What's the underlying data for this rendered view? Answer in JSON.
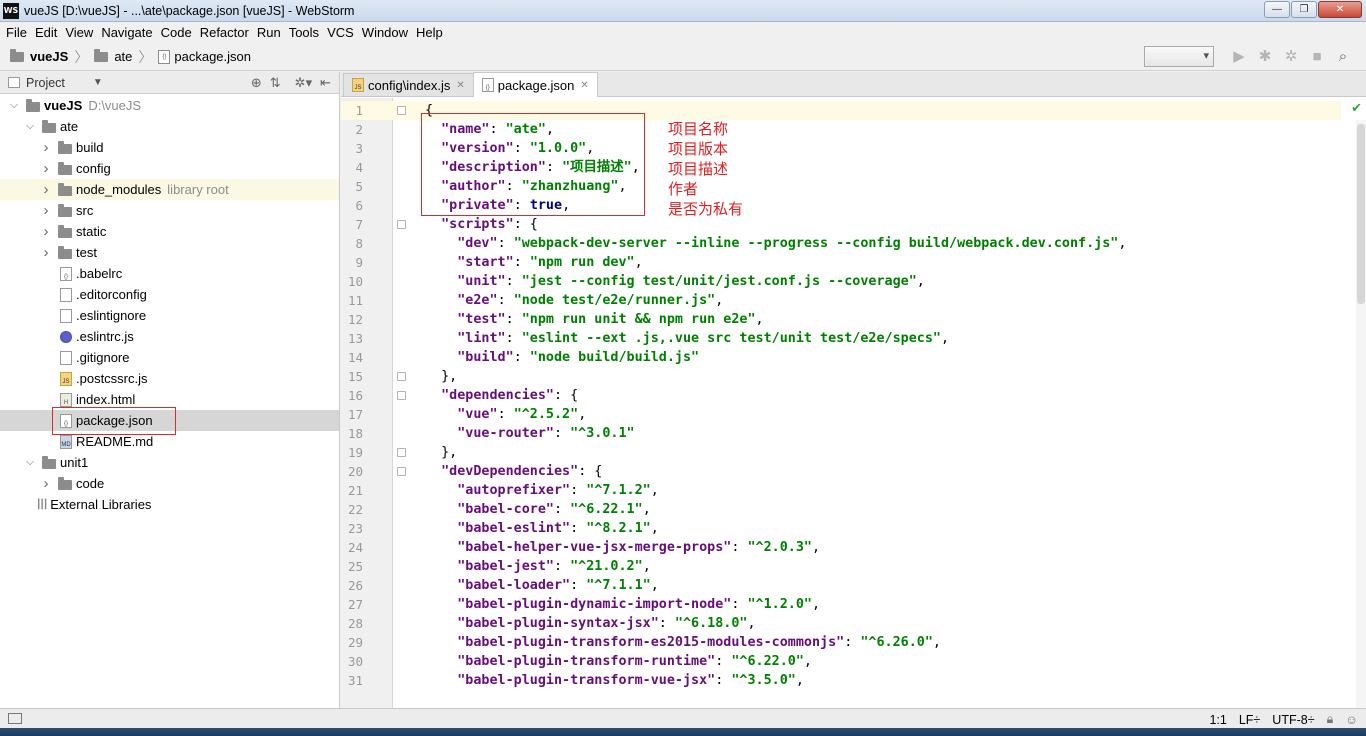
{
  "window": {
    "title": "vueJS [D:\\vueJS] - ...\\ate\\package.json [vueJS] - WebStorm",
    "app_icon": "WS",
    "minimize": "—",
    "maximize": "❐",
    "close": "✕"
  },
  "menu": [
    "File",
    "Edit",
    "View",
    "Navigate",
    "Code",
    "Refactor",
    "Run",
    "Tools",
    "VCS",
    "Window",
    "Help"
  ],
  "breadcrumb": {
    "root": "vueJS",
    "folder": "ate",
    "file": "package.json"
  },
  "project_panel": {
    "title": "Project",
    "tree": [
      {
        "label": "vueJS",
        "hint": "D:\\vueJS",
        "type": "folder",
        "depth": 0,
        "arrow": "down",
        "bold": true
      },
      {
        "label": "ate",
        "type": "folder",
        "depth": 1,
        "arrow": "down"
      },
      {
        "label": "build",
        "type": "folder",
        "depth": 2,
        "arrow": "right"
      },
      {
        "label": "config",
        "type": "folder",
        "depth": 2,
        "arrow": "right"
      },
      {
        "label": "node_modules",
        "hint": "library root",
        "type": "folder",
        "depth": 2,
        "arrow": "right",
        "highlight": true
      },
      {
        "label": "src",
        "type": "folder",
        "depth": 2,
        "arrow": "right"
      },
      {
        "label": "static",
        "type": "folder",
        "depth": 2,
        "arrow": "right"
      },
      {
        "label": "test",
        "type": "folder",
        "depth": 2,
        "arrow": "right"
      },
      {
        "label": ".babelrc",
        "type": "file",
        "depth": 3,
        "icon": "json"
      },
      {
        "label": ".editorconfig",
        "type": "file",
        "depth": 3,
        "icon": "text"
      },
      {
        "label": ".eslintignore",
        "type": "file",
        "depth": 3,
        "icon": "text"
      },
      {
        "label": ".eslintrc.js",
        "type": "file",
        "depth": 3,
        "icon": "eslint"
      },
      {
        "label": ".gitignore",
        "type": "file",
        "depth": 3,
        "icon": "text"
      },
      {
        "label": ".postcssrc.js",
        "type": "file",
        "depth": 3,
        "icon": "js"
      },
      {
        "label": "index.html",
        "type": "file",
        "depth": 3,
        "icon": "html"
      },
      {
        "label": "package.json",
        "type": "file",
        "depth": 3,
        "icon": "json",
        "selected": true
      },
      {
        "label": "README.md",
        "type": "file",
        "depth": 3,
        "icon": "md"
      },
      {
        "label": "unit1",
        "type": "folder",
        "depth": 1,
        "arrow": "down"
      },
      {
        "label": "code",
        "type": "folder",
        "depth": 2,
        "arrow": "right"
      },
      {
        "label": "External Libraries",
        "type": "lib",
        "depth": 1
      }
    ]
  },
  "tabs": [
    {
      "label": "config\\index.js",
      "icon": "js",
      "active": false
    },
    {
      "label": "package.json",
      "icon": "json",
      "active": true
    }
  ],
  "code_lines": [
    [
      [
        "p",
        "{"
      ]
    ],
    [
      [
        "p",
        "  "
      ],
      [
        "k",
        "\"name\""
      ],
      [
        "p",
        ": "
      ],
      [
        "s",
        "\"ate\""
      ],
      [
        "p",
        ","
      ]
    ],
    [
      [
        "p",
        "  "
      ],
      [
        "k",
        "\"version\""
      ],
      [
        "p",
        ": "
      ],
      [
        "s",
        "\"1.0.0\""
      ],
      [
        "p",
        ","
      ]
    ],
    [
      [
        "p",
        "  "
      ],
      [
        "k",
        "\"description\""
      ],
      [
        "p",
        ": "
      ],
      [
        "s",
        "\"项目描述\""
      ],
      [
        "p",
        ","
      ]
    ],
    [
      [
        "p",
        "  "
      ],
      [
        "k",
        "\"author\""
      ],
      [
        "p",
        ": "
      ],
      [
        "s",
        "\"zhanzhuang\""
      ],
      [
        "p",
        ","
      ]
    ],
    [
      [
        "p",
        "  "
      ],
      [
        "k",
        "\"private\""
      ],
      [
        "p",
        ": "
      ],
      [
        "kw",
        "true"
      ],
      [
        "p",
        ","
      ]
    ],
    [
      [
        "p",
        "  "
      ],
      [
        "k",
        "\"scripts\""
      ],
      [
        "p",
        ": {"
      ]
    ],
    [
      [
        "p",
        "    "
      ],
      [
        "k",
        "\"dev\""
      ],
      [
        "p",
        ": "
      ],
      [
        "s",
        "\"webpack-dev-server --inline --progress --config build/webpack.dev.conf.js\""
      ],
      [
        "p",
        ","
      ]
    ],
    [
      [
        "p",
        "    "
      ],
      [
        "k",
        "\"start\""
      ],
      [
        "p",
        ": "
      ],
      [
        "s",
        "\"npm run dev\""
      ],
      [
        "p",
        ","
      ]
    ],
    [
      [
        "p",
        "    "
      ],
      [
        "k",
        "\"unit\""
      ],
      [
        "p",
        ": "
      ],
      [
        "s",
        "\"jest --config test/unit/jest.conf.js --coverage\""
      ],
      [
        "p",
        ","
      ]
    ],
    [
      [
        "p",
        "    "
      ],
      [
        "k",
        "\"e2e\""
      ],
      [
        "p",
        ": "
      ],
      [
        "s",
        "\"node test/e2e/runner.js\""
      ],
      [
        "p",
        ","
      ]
    ],
    [
      [
        "p",
        "    "
      ],
      [
        "k",
        "\"test\""
      ],
      [
        "p",
        ": "
      ],
      [
        "s",
        "\"npm run unit && npm run e2e\""
      ],
      [
        "p",
        ","
      ]
    ],
    [
      [
        "p",
        "    "
      ],
      [
        "k",
        "\"lint\""
      ],
      [
        "p",
        ": "
      ],
      [
        "s",
        "\"eslint --ext .js,.vue src test/unit test/e2e/specs\""
      ],
      [
        "p",
        ","
      ]
    ],
    [
      [
        "p",
        "    "
      ],
      [
        "k",
        "\"build\""
      ],
      [
        "p",
        ": "
      ],
      [
        "s",
        "\"node build/build.js\""
      ]
    ],
    [
      [
        "p",
        "  },"
      ]
    ],
    [
      [
        "p",
        "  "
      ],
      [
        "k",
        "\"dependencies\""
      ],
      [
        "p",
        ": {"
      ]
    ],
    [
      [
        "p",
        "    "
      ],
      [
        "k",
        "\"vue\""
      ],
      [
        "p",
        ": "
      ],
      [
        "s",
        "\"^2.5.2\""
      ],
      [
        "p",
        ","
      ]
    ],
    [
      [
        "p",
        "    "
      ],
      [
        "k",
        "\"vue-router\""
      ],
      [
        "p",
        ": "
      ],
      [
        "s",
        "\"^3.0.1\""
      ]
    ],
    [
      [
        "p",
        "  },"
      ]
    ],
    [
      [
        "p",
        "  "
      ],
      [
        "k",
        "\"devDependencies\""
      ],
      [
        "p",
        ": {"
      ]
    ],
    [
      [
        "p",
        "    "
      ],
      [
        "k",
        "\"autoprefixer\""
      ],
      [
        "p",
        ": "
      ],
      [
        "s",
        "\"^7.1.2\""
      ],
      [
        "p",
        ","
      ]
    ],
    [
      [
        "p",
        "    "
      ],
      [
        "k",
        "\"babel-core\""
      ],
      [
        "p",
        ": "
      ],
      [
        "s",
        "\"^6.22.1\""
      ],
      [
        "p",
        ","
      ]
    ],
    [
      [
        "p",
        "    "
      ],
      [
        "k",
        "\"babel-eslint\""
      ],
      [
        "p",
        ": "
      ],
      [
        "s",
        "\"^8.2.1\""
      ],
      [
        "p",
        ","
      ]
    ],
    [
      [
        "p",
        "    "
      ],
      [
        "k",
        "\"babel-helper-vue-jsx-merge-props\""
      ],
      [
        "p",
        ": "
      ],
      [
        "s",
        "\"^2.0.3\""
      ],
      [
        "p",
        ","
      ]
    ],
    [
      [
        "p",
        "    "
      ],
      [
        "k",
        "\"babel-jest\""
      ],
      [
        "p",
        ": "
      ],
      [
        "s",
        "\"^21.0.2\""
      ],
      [
        "p",
        ","
      ]
    ],
    [
      [
        "p",
        "    "
      ],
      [
        "k",
        "\"babel-loader\""
      ],
      [
        "p",
        ": "
      ],
      [
        "s",
        "\"^7.1.1\""
      ],
      [
        "p",
        ","
      ]
    ],
    [
      [
        "p",
        "    "
      ],
      [
        "k",
        "\"babel-plugin-dynamic-import-node\""
      ],
      [
        "p",
        ": "
      ],
      [
        "s",
        "\"^1.2.0\""
      ],
      [
        "p",
        ","
      ]
    ],
    [
      [
        "p",
        "    "
      ],
      [
        "k",
        "\"babel-plugin-syntax-jsx\""
      ],
      [
        "p",
        ": "
      ],
      [
        "s",
        "\"^6.18.0\""
      ],
      [
        "p",
        ","
      ]
    ],
    [
      [
        "p",
        "    "
      ],
      [
        "k",
        "\"babel-plugin-transform-es2015-modules-commonjs\""
      ],
      [
        "p",
        ": "
      ],
      [
        "s",
        "\"^6.26.0\""
      ],
      [
        "p",
        ","
      ]
    ],
    [
      [
        "p",
        "    "
      ],
      [
        "k",
        "\"babel-plugin-transform-runtime\""
      ],
      [
        "p",
        ": "
      ],
      [
        "s",
        "\"^6.22.0\""
      ],
      [
        "p",
        ","
      ]
    ],
    [
      [
        "p",
        "    "
      ],
      [
        "k",
        "\"babel-plugin-transform-vue-jsx\""
      ],
      [
        "p",
        ": "
      ],
      [
        "s",
        "\"^3.5.0\""
      ],
      [
        "p",
        ","
      ]
    ]
  ],
  "annotations": [
    "项目名称",
    "项目版本",
    "项目描述",
    "作者",
    "是否为私有"
  ],
  "status": {
    "position": "1:1",
    "line_sep": "LF÷",
    "encoding": "UTF-8÷"
  },
  "colors": {
    "key": "#660e7a",
    "string": "#008000",
    "keyword": "#000080",
    "annotation": "#e02020"
  }
}
